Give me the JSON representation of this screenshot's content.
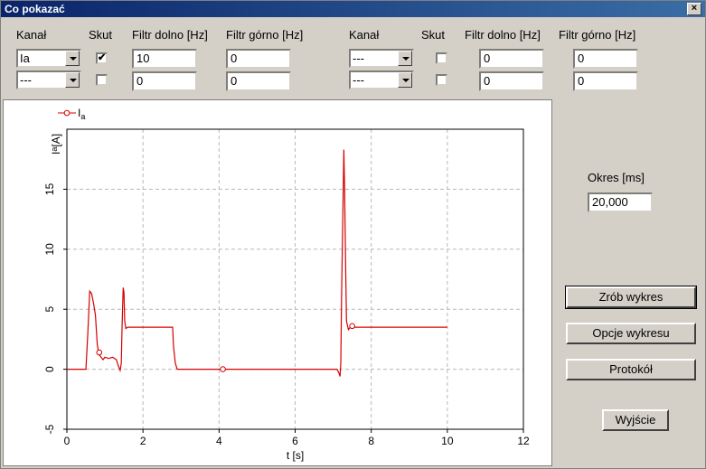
{
  "window": {
    "title": "Co pokazać",
    "close_glyph": "×"
  },
  "group_left": {
    "headers": {
      "channel": "Kanał",
      "skut": "Skut",
      "lowpass": "Filtr dolno [Hz]",
      "highpass": "Filtr górno [Hz]"
    },
    "rows": [
      {
        "channel": "Ia",
        "skut": "✔",
        "lowpass": "10",
        "highpass": "0"
      },
      {
        "channel": "---",
        "skut": "",
        "lowpass": "0",
        "highpass": "0"
      }
    ]
  },
  "group_right": {
    "headers": {
      "channel": "Kanał",
      "skut": "Skut",
      "lowpass": "Filtr dolno [Hz]",
      "highpass": "Filtr górno [Hz]"
    },
    "rows": [
      {
        "channel": "---",
        "skut": "",
        "lowpass": "0",
        "highpass": "0"
      },
      {
        "channel": "---",
        "skut": "",
        "lowpass": "0",
        "highpass": "0"
      }
    ]
  },
  "period": {
    "label": "Okres [ms]",
    "value": "20,000"
  },
  "buttons": {
    "make_chart": "Zrób wykres",
    "chart_options": "Opcje wykresu",
    "protocol": "Protokół",
    "exit": "Wyjście"
  },
  "colors": {
    "series": "#d40000",
    "grid": "#b8b8b8"
  },
  "chart_data": {
    "type": "line",
    "xlabel": "t [s]",
    "ylabel_main": "I",
    "ylabel_sub": "a",
    "ylabel_unit": "[A]",
    "legend_main": "I",
    "legend_sub": "a",
    "legend_position": "top-left",
    "grid": true,
    "xlim": [
      0,
      12
    ],
    "ylim": [
      -5,
      20
    ],
    "xticks": [
      "0",
      "2",
      "4",
      "6",
      "8",
      "10",
      "12"
    ],
    "yticks": [
      "-5",
      "0",
      "5",
      "10",
      "15"
    ],
    "series": [
      {
        "name": "Ia",
        "x": [
          0,
          0.5,
          0.55,
          0.6,
          0.65,
          0.7,
          0.75,
          0.8,
          0.85,
          0.9,
          0.95,
          1.0,
          1.1,
          1.2,
          1.3,
          1.35,
          1.4,
          1.43,
          1.45,
          1.48,
          1.5,
          1.52,
          1.55,
          1.6,
          1.7,
          1.8,
          2.0,
          2.5,
          2.7,
          2.78,
          2.8,
          2.85,
          2.9,
          4.0,
          7.1,
          7.15,
          7.18,
          7.2,
          7.22,
          7.25,
          7.28,
          7.3,
          7.33,
          7.35,
          7.4,
          7.45,
          7.5,
          8.0,
          9.0,
          10.0
        ],
        "y": [
          0,
          0,
          3.0,
          6.5,
          6.3,
          5.5,
          4.5,
          2.0,
          1.2,
          1.0,
          0.8,
          1.0,
          0.9,
          1.0,
          0.8,
          0.3,
          -0.1,
          0.5,
          3.5,
          6.8,
          6.4,
          4.0,
          3.4,
          3.5,
          3.5,
          3.5,
          3.5,
          3.5,
          3.5,
          3.5,
          2.0,
          0.5,
          0,
          0,
          0,
          -0.3,
          -0.6,
          0.5,
          6.0,
          12.0,
          18.3,
          15.0,
          8.0,
          4.0,
          3.3,
          3.5,
          3.5,
          3.5,
          3.5,
          3.5
        ],
        "markers": [
          [
            0.85,
            1.4
          ],
          [
            4.1,
            0
          ],
          [
            7.5,
            3.6
          ]
        ]
      }
    ]
  }
}
